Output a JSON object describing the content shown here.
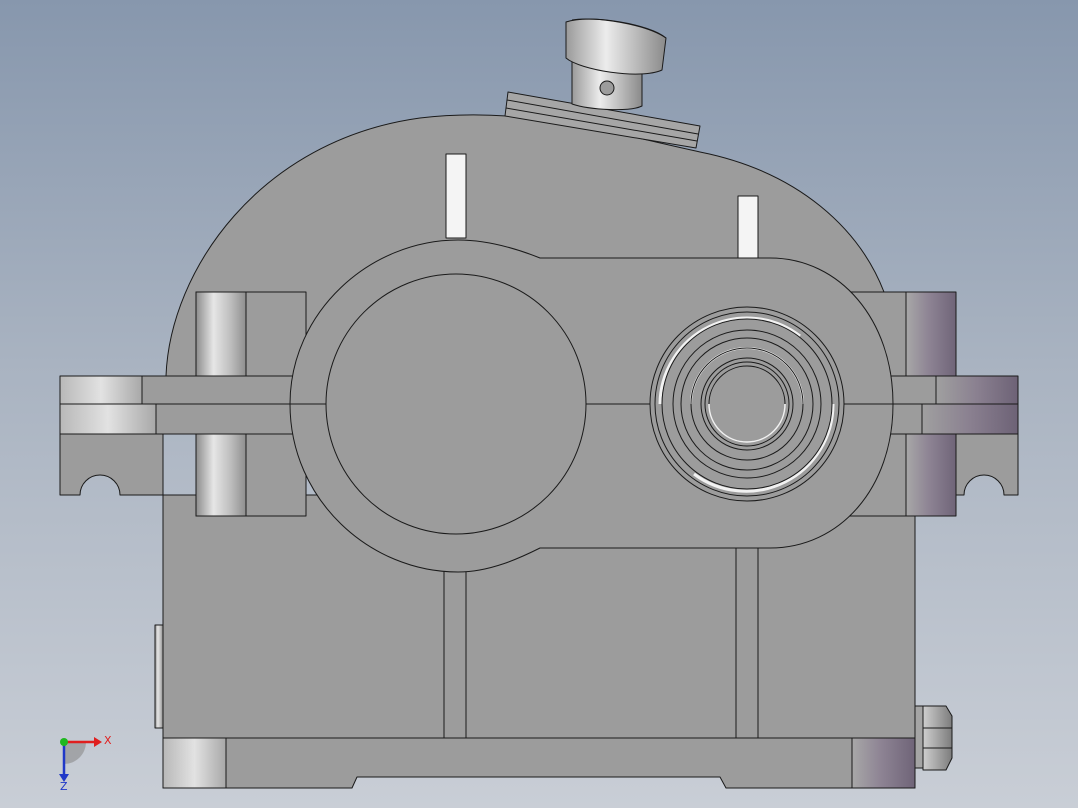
{
  "viewport": {
    "background_top": "#8797ad",
    "background_bottom": "#c9ced6",
    "part_color": "#9c9c9c",
    "edge_color": "#1a1a1a",
    "highlight_color": "#f2f2f2",
    "shaded_purple": "#7f7488"
  },
  "model": {
    "type": "gear-reducer-housing",
    "view": "front"
  },
  "triad": {
    "x_label": "X",
    "z_label": "Z",
    "x_color": "#e01f1f",
    "y_color": "#1fb81f",
    "z_color": "#2038c8"
  }
}
